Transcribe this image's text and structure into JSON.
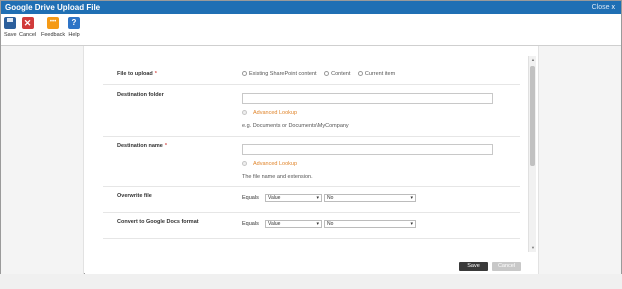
{
  "window": {
    "title": "Google Drive Upload File",
    "close_label": "Close",
    "close_glyph": "x"
  },
  "ribbon": {
    "buttons": [
      {
        "label": "Save",
        "icon": "save-icon"
      },
      {
        "label": "Cancel",
        "icon": "cancel-icon"
      },
      {
        "label": "Feedback",
        "icon": "feedback-icon"
      },
      {
        "label": "Help",
        "icon": "help-icon"
      }
    ],
    "cancel_glyph": "✕",
    "feedback_glyph": "•••",
    "help_glyph": "?"
  },
  "form": {
    "file_to_upload": {
      "label": "File to upload",
      "required_mark": "*",
      "options": [
        "Existing SharePoint content",
        "Content",
        "Current item"
      ]
    },
    "destination_folder": {
      "label": "Destination folder",
      "value": "",
      "advanced_lookup": "Advanced Lookup",
      "hint": "e.g. Documents or Documents\\MyCompany"
    },
    "destination_name": {
      "label": "Destination name",
      "required_mark": "*",
      "value": "",
      "advanced_lookup": "Advanced Lookup",
      "hint": "The file name and extension."
    },
    "overwrite_file": {
      "label": "Overwrite file",
      "equals": "Equals",
      "type_value": "Value",
      "value": "No"
    },
    "convert_google_docs": {
      "label": "Convert to Google Docs format",
      "equals": "Equals",
      "type_value": "Value",
      "value": "No"
    }
  },
  "scroll": {
    "up": "▲",
    "down": "▼"
  },
  "footer": {
    "save_label": "Save",
    "cancel_label": "Cancel"
  },
  "dropdown_arrow": "▾",
  "colors": {
    "titlebar": "#1f6fb4",
    "link": "#e0852c",
    "required": "#d9534f",
    "save_button": "#3a3a3a"
  }
}
